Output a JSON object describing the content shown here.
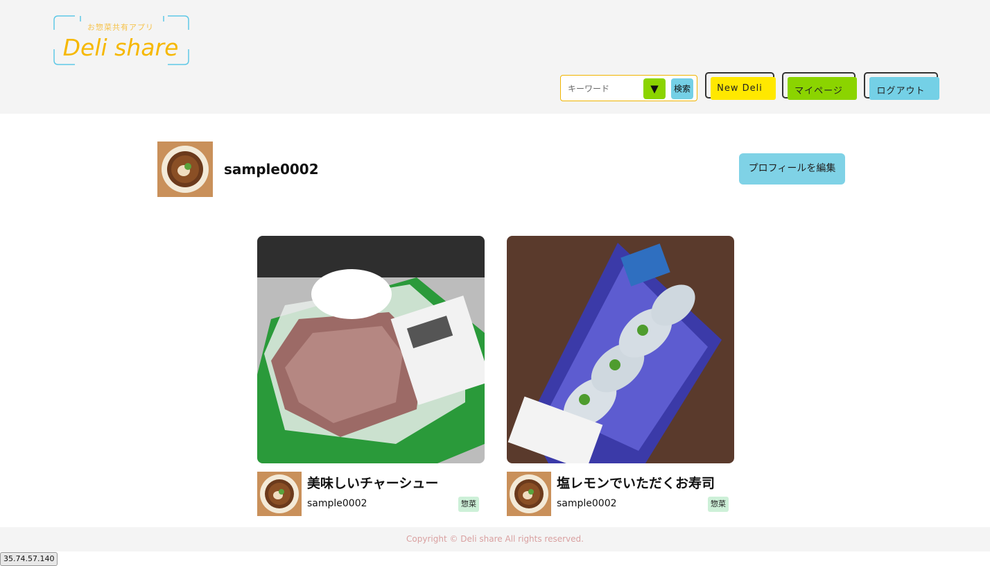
{
  "header": {
    "logo": {
      "subtitle": "お惣菜共有アプリ",
      "title": "Deli share"
    },
    "search": {
      "placeholder": "キーワード",
      "dropdown_icon": "▼",
      "submit_label": "検索"
    },
    "nav": [
      {
        "label": "New Deli",
        "color": "#ffe800"
      },
      {
        "label": "マイページ",
        "color": "#8bd400"
      },
      {
        "label": "ログアウト",
        "color": "#74d0e6"
      }
    ]
  },
  "profile": {
    "username": "sample0002",
    "edit_label": "プロフィールを編集"
  },
  "posts": [
    {
      "title": "美味しいチャーシュー",
      "author": "sample0002",
      "tag": "惣菜"
    },
    {
      "title": "塩レモンでいただくお寿司",
      "author": "sample0002",
      "tag": "惣菜"
    }
  ],
  "footer": {
    "copyright": "Copyright © Deli share All rights reserved."
  },
  "status_text": "35.74.57.140",
  "colors": {
    "header_bg": "#f4f4f4",
    "logo_yellow": "#f6b800",
    "logo_frame": "#5ec8e6",
    "accent_blue": "#7fd2e6",
    "tag_green": "#cdf0d8"
  }
}
